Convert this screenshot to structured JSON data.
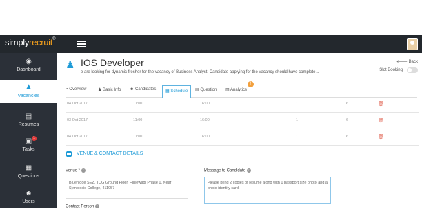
{
  "header": {
    "logo_main": "simply",
    "logo_accent": "recruit",
    "logo_mark": "®"
  },
  "sidebar": {
    "items": [
      {
        "label": "Dashboard",
        "icon": "dashboard-icon"
      },
      {
        "label": "Vacancies",
        "icon": "vacancies-icon",
        "active": true
      },
      {
        "label": "Resumes",
        "icon": "resumes-icon"
      },
      {
        "label": "Tasks",
        "icon": "tasks-icon",
        "badge": "1"
      },
      {
        "label": "Questions",
        "icon": "questions-icon"
      },
      {
        "label": "Users",
        "icon": "users-icon"
      }
    ]
  },
  "job": {
    "title": "IOS Developer",
    "description": "e are looking for dynamic fresher for the vacancy of Business Analyst. Candidate applying for the vacancy should have complete...",
    "back_label": "Back",
    "slot_booking_label": "Slot Booking"
  },
  "tabs": [
    {
      "label": "Overview"
    },
    {
      "label": "Basic Info"
    },
    {
      "label": "Candidates"
    },
    {
      "label": "Schedule",
      "active": true
    },
    {
      "label": "Question"
    },
    {
      "label": "Analytics",
      "alert": "!"
    }
  ],
  "schedule_rows": [
    {
      "date": "04 Oct 2017",
      "start": "11:00",
      "end": "16:00",
      "count_a": "1",
      "count_b": "6"
    },
    {
      "date": "03 Oct 2017",
      "start": "11:00",
      "end": "16:00",
      "count_a": "1",
      "count_b": "6"
    },
    {
      "date": "04 Oct 2017",
      "start": "11:00",
      "end": "16:00",
      "count_a": "1",
      "count_b": "6"
    }
  ],
  "venue_section": {
    "title": "VENUE & CONTACT DETAILS",
    "venue_label": "Venue *",
    "venue_value": "Bluenidge SEZ, TCG Ground Floor, Hinjewadi Phase 1, Near Symbiosis College, 411057",
    "message_label": "Message to Candidate",
    "message_value": "Please bring 2 copies of resume along with 1 passport size photo and a photo identity card.",
    "contact_label": "Contact Person"
  },
  "colors": {
    "accent": "#1f9bd7",
    "sidebar": "#2b3038",
    "topbar": "#23282d",
    "logo_accent": "#f4a01d",
    "delete": "#e26b5b"
  }
}
